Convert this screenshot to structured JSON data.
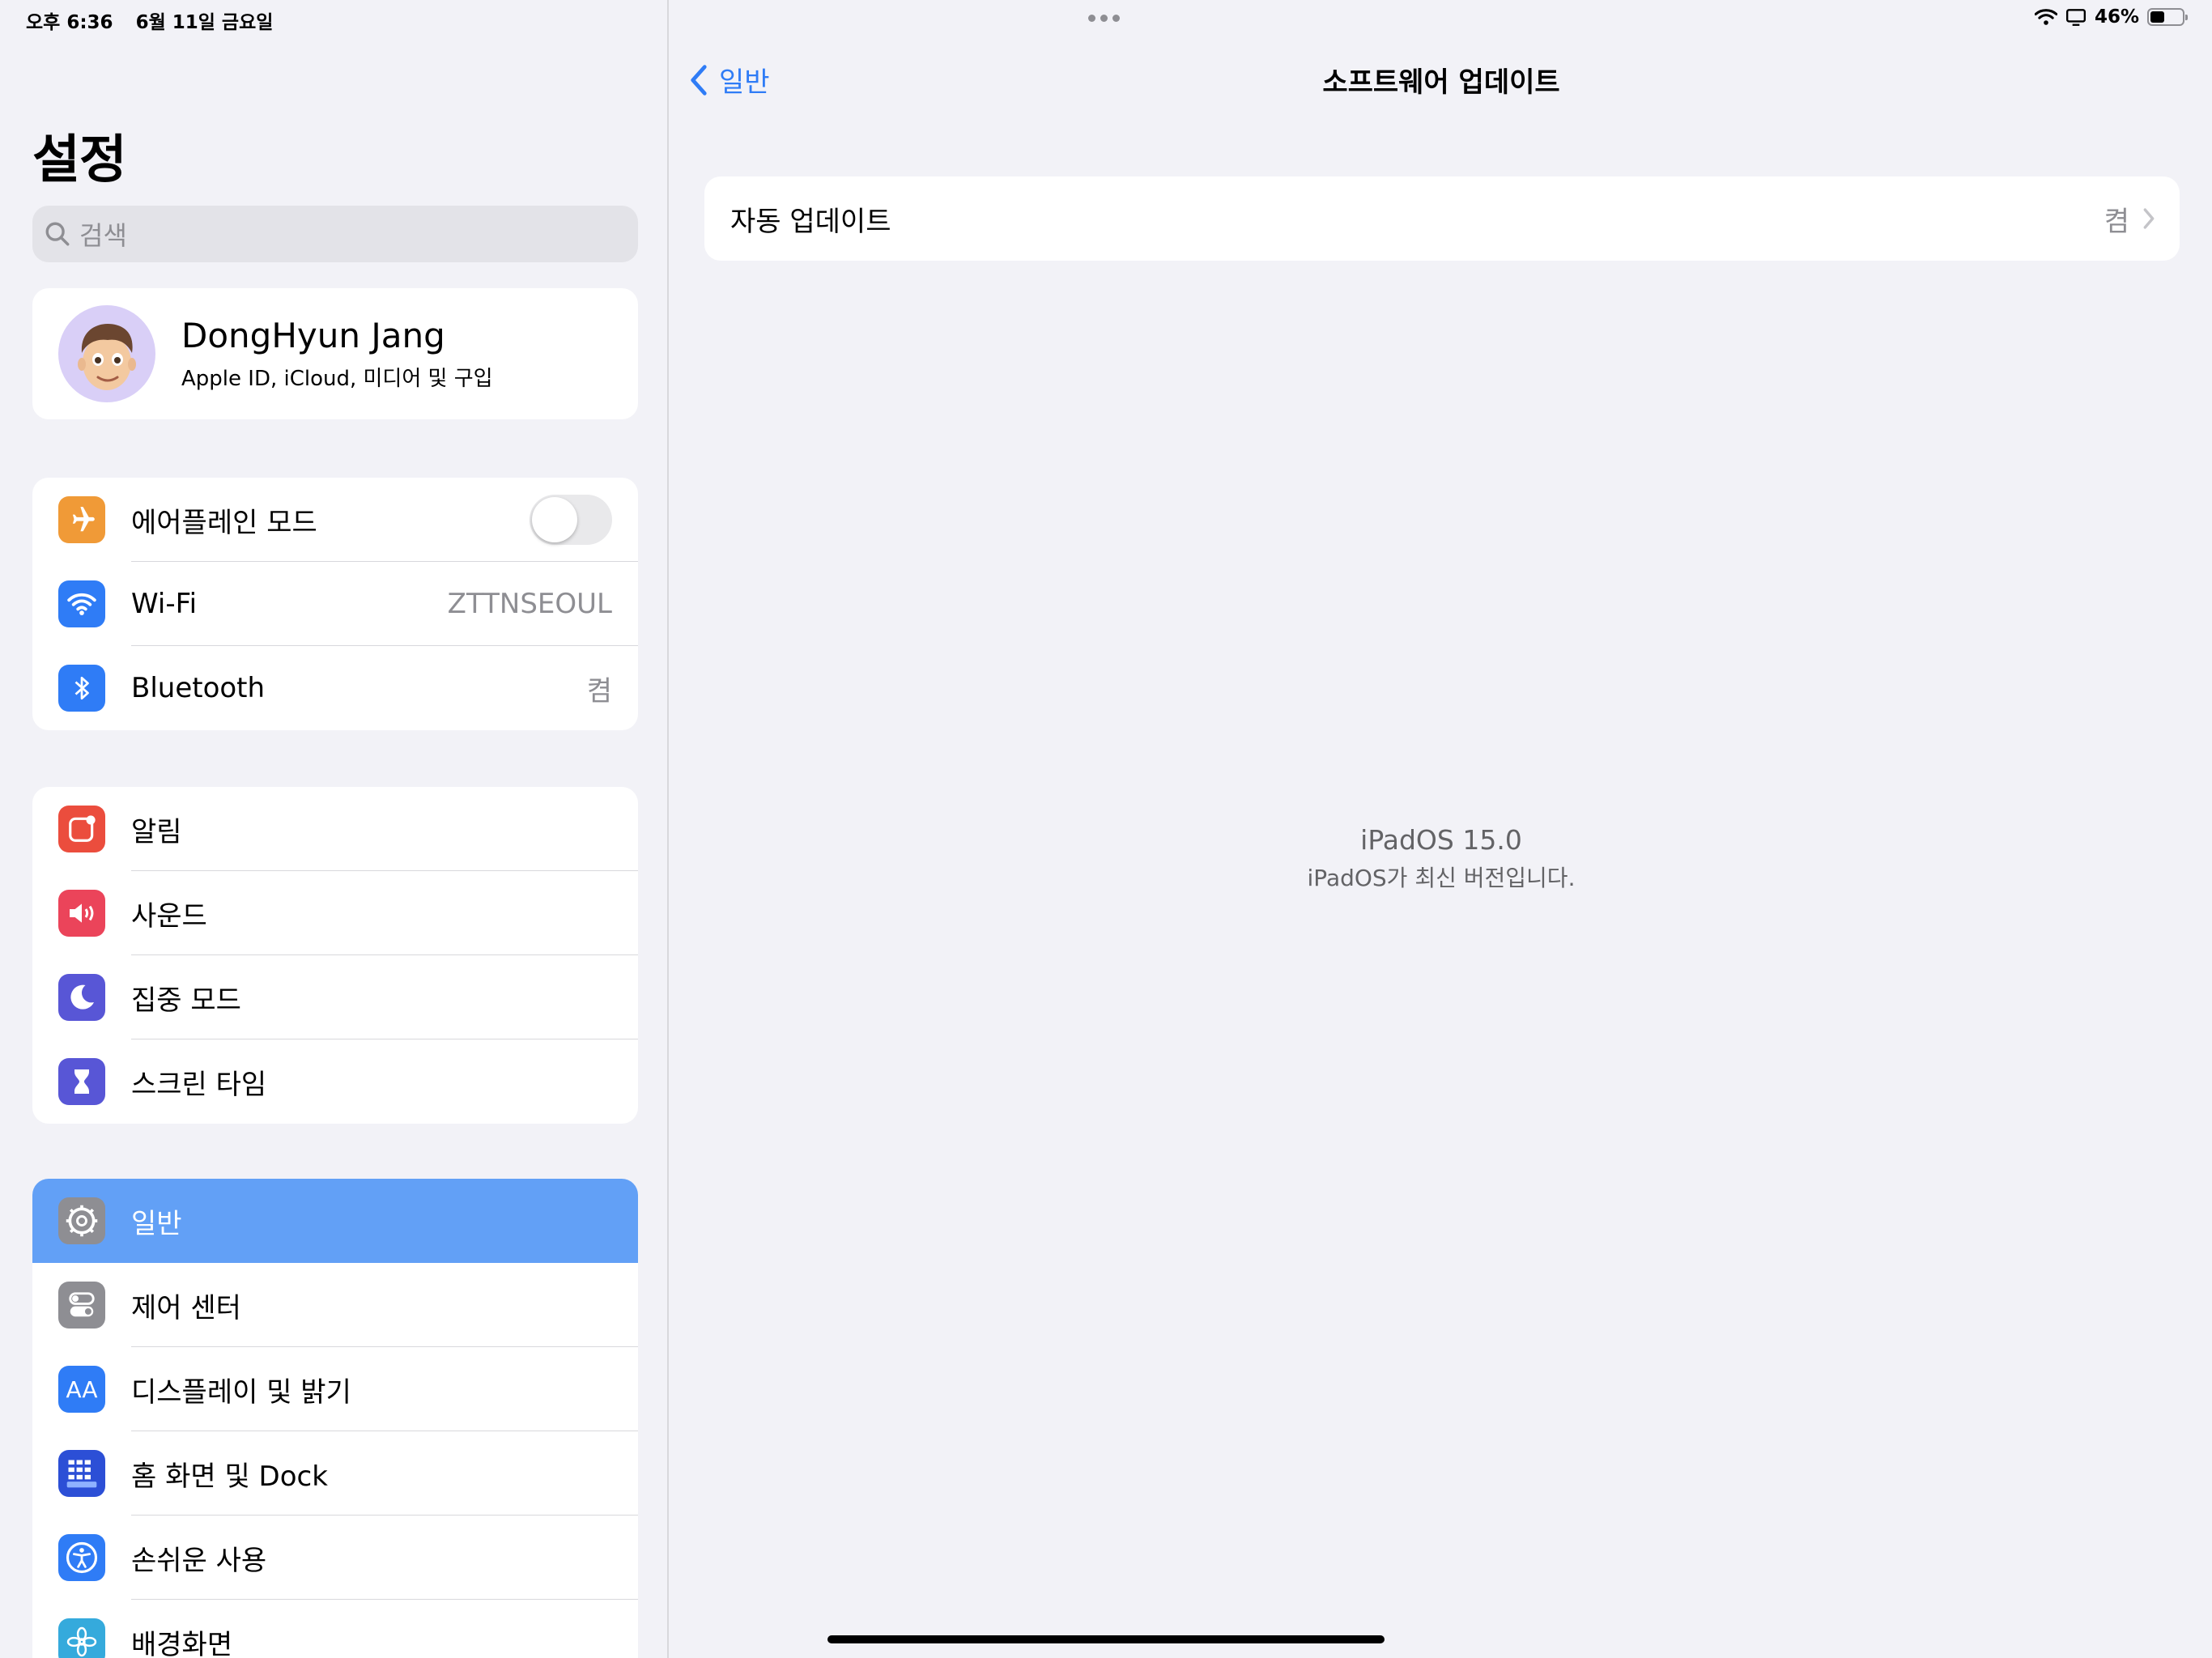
{
  "status_bar": {
    "time": "오후 6:36",
    "date": "6월 11일 금요일",
    "battery_text": "46%",
    "battery_level": 0.46
  },
  "sidebar": {
    "title": "설정",
    "search_placeholder": "검색",
    "profile": {
      "name": "DongHyun Jang",
      "subtitle": "Apple ID, iCloud, 미디어 및 구입"
    },
    "group1": [
      {
        "label": "에어플레인 모드",
        "icon": "airplane-icon",
        "color": "#f09a37",
        "toggle": false
      },
      {
        "label": "Wi-Fi",
        "icon": "wifi-icon",
        "color": "#2f7cf6",
        "value": "ZTTNSEOUL"
      },
      {
        "label": "Bluetooth",
        "icon": "bluetooth-icon",
        "color": "#2f7cf6",
        "value": "켬"
      }
    ],
    "group2": [
      {
        "label": "알림",
        "icon": "notifications-icon",
        "color": "#eb4d3d"
      },
      {
        "label": "사운드",
        "icon": "sound-icon",
        "color": "#eb445a"
      },
      {
        "label": "집중 모드",
        "icon": "moon-icon",
        "color": "#5856d6"
      },
      {
        "label": "스크린 타임",
        "icon": "hourglass-icon",
        "color": "#5856d6"
      }
    ],
    "group3": [
      {
        "label": "일반",
        "icon": "gear-icon",
        "color": "#8e8e93",
        "selected": true
      },
      {
        "label": "제어 센터",
        "icon": "switches-icon",
        "color": "#8e8e93"
      },
      {
        "label": "디스플레이 및 밝기",
        "icon": "text-size-icon",
        "color": "#2f7cf6",
        "icon_text": "AA"
      },
      {
        "label": "홈 화면 및 Dock",
        "icon": "home-grid-icon",
        "color": "#2c4fd6"
      },
      {
        "label": "손쉬운 사용",
        "icon": "accessibility-icon",
        "color": "#2f7cf6"
      },
      {
        "label": "배경화면",
        "icon": "flower-icon",
        "color": "#35aadc"
      }
    ]
  },
  "detail": {
    "back_label": "일반",
    "title": "소프트웨어 업데이트",
    "auto_update_label": "자동 업데이트",
    "auto_update_value": "켬",
    "version_name": "iPadOS 15.0",
    "version_status": "iPadOS가 최신 버전입니다."
  }
}
